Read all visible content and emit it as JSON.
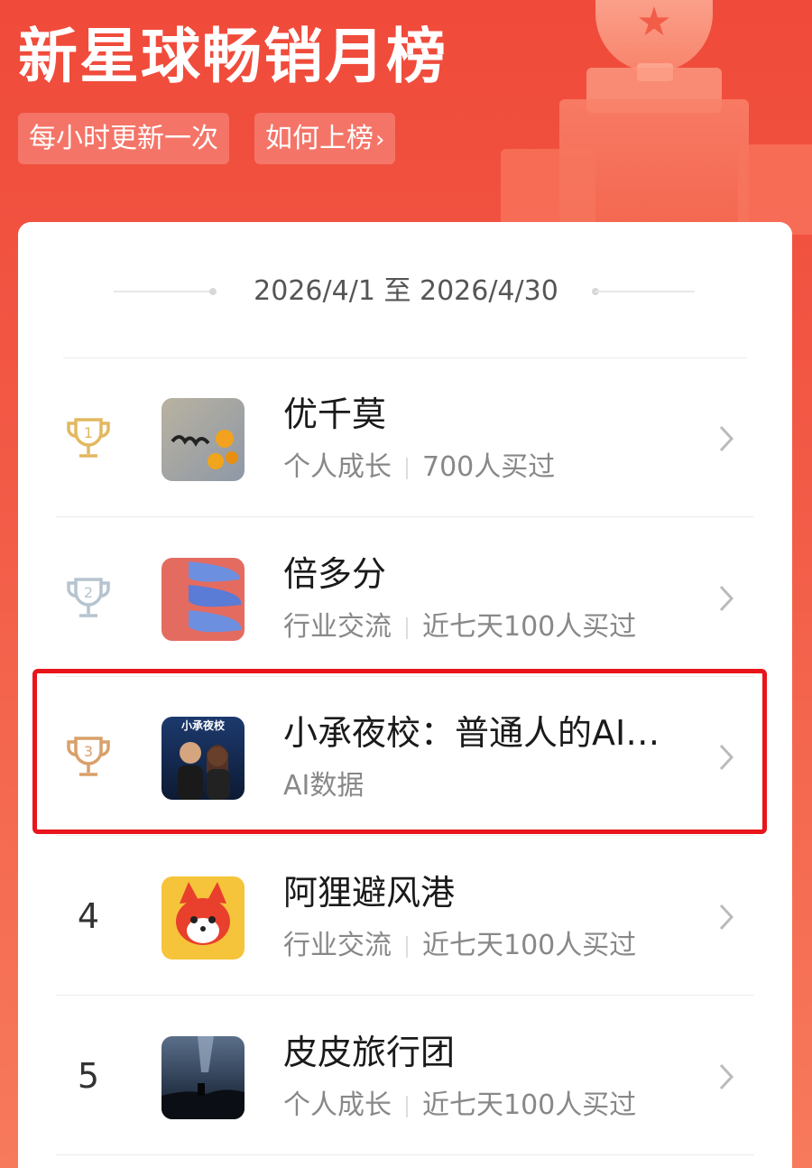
{
  "header": {
    "title": "新星球畅销月榜",
    "chip_update": "每小时更新一次",
    "chip_howto": "如何上榜",
    "chip_howto_arrow": "›"
  },
  "date_range": "2026/4/1 至 2026/4/30",
  "colors": {
    "header_red": "#f04a3a",
    "gold_trophy": "#e2b860",
    "silver_trophy": "#b6c4cf",
    "bronze_trophy": "#d9a06a",
    "highlight_red": "#e8161b"
  },
  "ranking": [
    {
      "rank": "1",
      "name": "优千莫",
      "category": "个人成长",
      "buyers": "700人买过",
      "trophy": "gold-trophy-icon"
    },
    {
      "rank": "2",
      "name": "倍多分",
      "category": "行业交流",
      "buyers": "近七天100人买过",
      "trophy": "silver-trophy-icon"
    },
    {
      "rank": "3",
      "name": "小承夜校：普通人的AI…",
      "category": "AI数据",
      "buyers": "",
      "trophy": "bronze-trophy-icon",
      "thumb_text": "小承夜校"
    },
    {
      "rank": "4",
      "name": "阿狸避风港",
      "category": "行业交流",
      "buyers": "近七天100人买过"
    },
    {
      "rank": "5",
      "name": "皮皮旅行团",
      "category": "个人成长",
      "buyers": "近七天100人买过"
    }
  ]
}
